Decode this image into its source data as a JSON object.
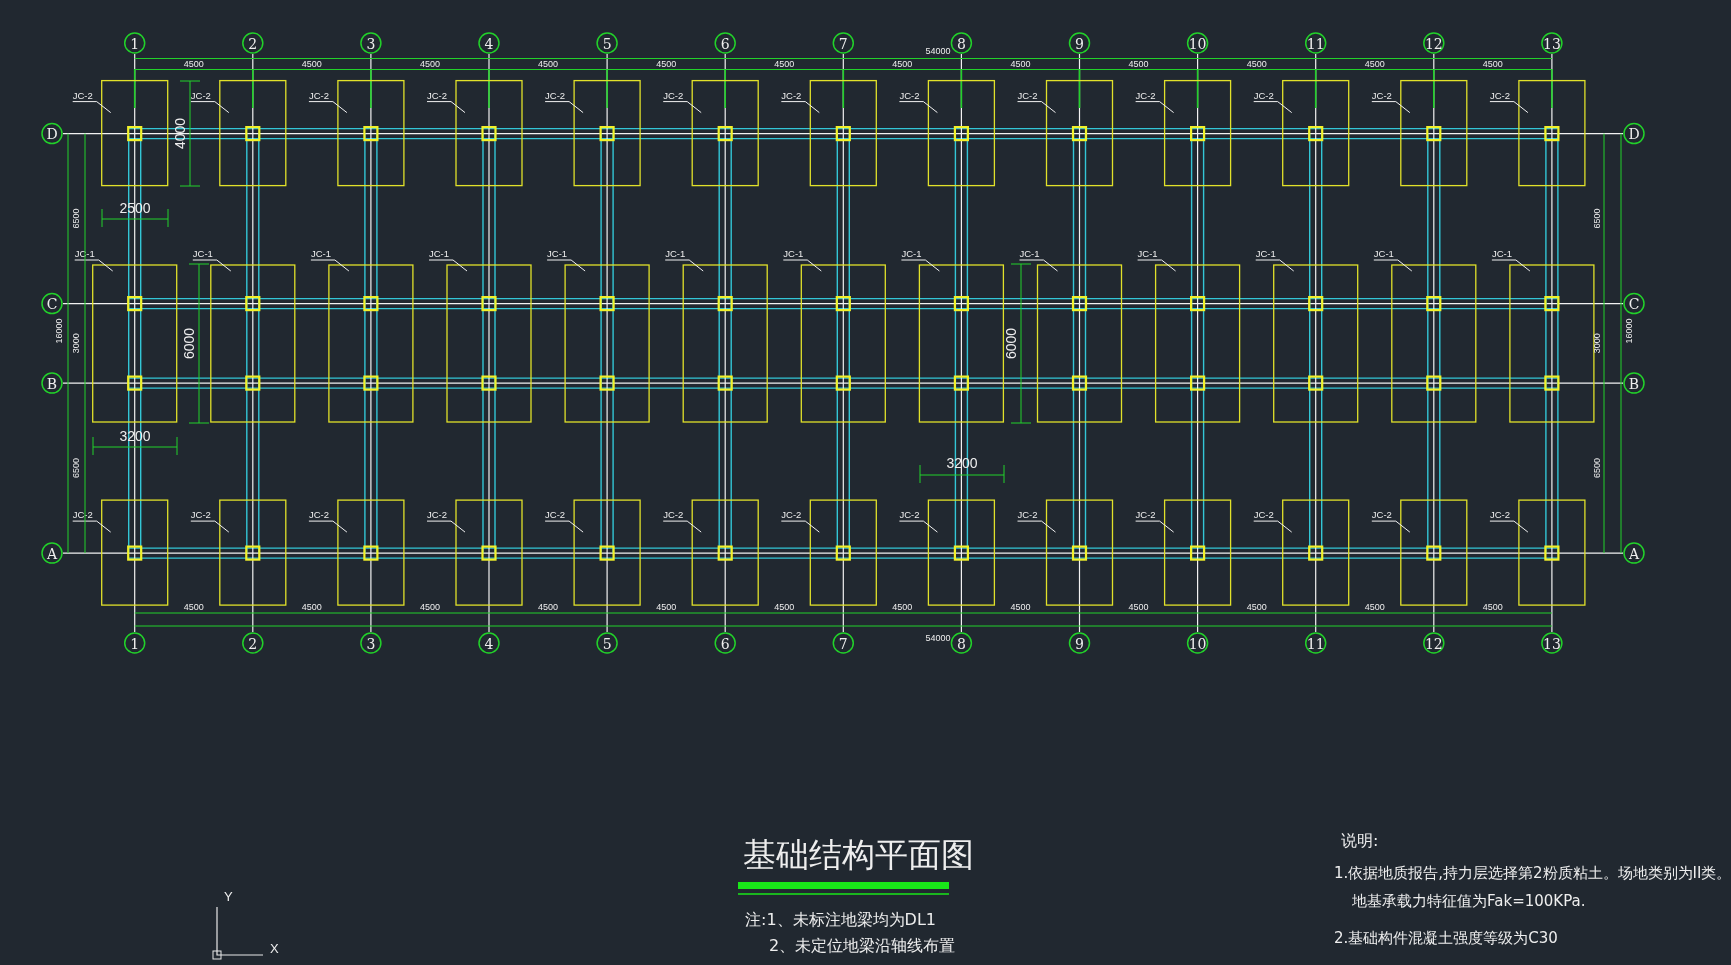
{
  "drawing": {
    "top_axis_labels": [
      "1",
      "2",
      "3",
      "4",
      "5",
      "6",
      "7",
      "8",
      "9",
      "10",
      "11",
      "12",
      "13"
    ],
    "bottom_axis_labels": [
      "1",
      "2",
      "3",
      "4",
      "5",
      "6",
      "7",
      "8",
      "9",
      "10",
      "11",
      "12",
      "13"
    ],
    "left_axis_labels": [
      "D",
      "C",
      "B",
      "A"
    ],
    "right_axis_labels": [
      "D",
      "C",
      "B",
      "A"
    ],
    "top_dimensions": {
      "total": "54000",
      "spans": [
        "4500",
        "4500",
        "4500",
        "4500",
        "4500",
        "4500",
        "4500",
        "4500",
        "4500",
        "4500",
        "4500",
        "4500"
      ]
    },
    "bottom_dimensions": {
      "total": "54000",
      "spans": [
        "4500",
        "4500",
        "4500",
        "4500",
        "4500",
        "4500",
        "4500",
        "4500",
        "4500",
        "4500",
        "4500",
        "4500"
      ]
    },
    "left_dimensions": {
      "total": "16000",
      "spans": [
        "6500",
        "3000",
        "6500"
      ]
    },
    "right_dimensions": {
      "total": "16000",
      "spans": [
        "6500",
        "3000",
        "6500"
      ]
    },
    "footing_rows": [
      {
        "kind": "small",
        "labels": [
          "JC-2",
          "JC-2",
          "JC-2",
          "JC-2",
          "JC-2",
          "JC-2",
          "JC-2",
          "JC-2",
          "JC-2",
          "JC-2",
          "JC-2",
          "JC-2",
          "JC-2"
        ]
      },
      {
        "kind": "large",
        "labels": [
          "JC-1",
          "JC-1",
          "JC-1",
          "JC-1",
          "JC-1",
          "JC-1",
          "JC-1",
          "JC-1",
          "JC-1",
          "JC-1",
          "JC-1",
          "JC-1",
          "JC-1"
        ]
      },
      {
        "kind": "small",
        "labels": [
          "JC-2",
          "JC-2",
          "JC-2",
          "JC-2",
          "JC-2",
          "JC-2",
          "JC-2",
          "JC-2",
          "JC-2",
          "JC-2",
          "JC-2",
          "JC-2",
          "JC-2"
        ]
      }
    ],
    "detail_dimensions": [
      "4000",
      "2500",
      "6000",
      "3200",
      "6000",
      "3200"
    ],
    "title": "基础结构平面图",
    "notes": [
      "注:1、未标注地梁均为DL1",
      "2、未定位地梁沿轴线布置"
    ],
    "specification": {
      "heading": "说明:",
      "lines": [
        "1.依据地质报告,持力层选择第2粉质粘土。场地类别为II类。",
        "地基承载力特征值为Fak=100KPa.",
        "2.基础构件混凝土强度等级为C30"
      ]
    },
    "ucs": {
      "y_label": "Y",
      "x_label": "X"
    }
  }
}
